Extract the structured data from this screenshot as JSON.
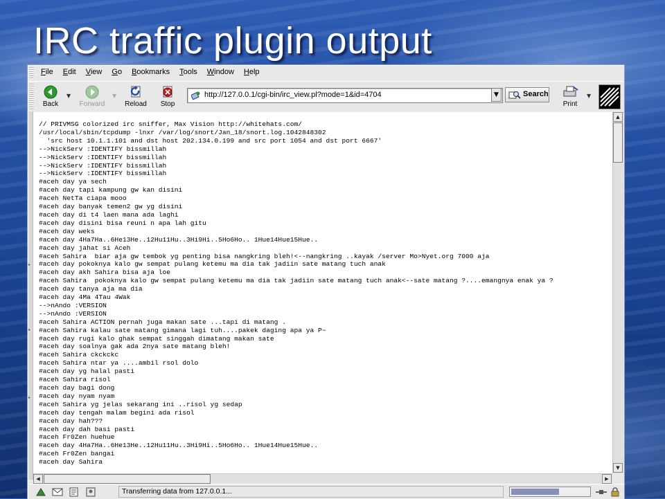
{
  "slide": {
    "title": "IRC traffic plugin output"
  },
  "browser": {
    "menu": [
      {
        "label": "File"
      },
      {
        "label": "Edit"
      },
      {
        "label": "View"
      },
      {
        "label": "Go"
      },
      {
        "label": "Bookmarks"
      },
      {
        "label": "Tools"
      },
      {
        "label": "Window"
      },
      {
        "label": "Help"
      }
    ],
    "toolbar": {
      "back_label": "Back",
      "forward_label": "Forward",
      "reload_label": "Reload",
      "stop_label": "Stop",
      "search_label": "Search",
      "print_label": "Print"
    },
    "url": "http://127.0.0.1/cgi-bin/irc_view.pl?mode=1&id=4704",
    "status_text": "Transferring data from 127.0.0.1...",
    "progress": 0.62,
    "icons": {
      "back": "back-arrow-icon",
      "forward": "forward-arrow-icon",
      "reload": "reload-icon",
      "stop": "stop-icon",
      "search": "search-icon",
      "print": "printer-icon",
      "throbber": "throbber-logo-icon"
    },
    "colors": {
      "accent_green": "#2d9a2d",
      "progress_fill": "#8a8fb8"
    }
  },
  "log_lines": [
    "// PRIVMSG colorized irc sniffer, Max Vision http://whitehats.com/",
    "/usr/local/sbin/tcpdump -lnxr /var/log/snort/Jan_18/snort.log.1042848302",
    "  'src host 10.1.1.101 and dst host 202.134.0.199 and src port 1054 and dst port 6667'",
    "-->NickServ :IDENTIFY bissmillah",
    "-->NickServ :IDENTIFY bissmillah",
    "-->NickServ :IDENTIFY bissmillah",
    "-->NickServ :IDENTIFY bissmillah",
    "#aceh day ya sech",
    "#aceh day tapi kampung gw kan disini",
    "#aceh NetTa ciapa mooo",
    "#aceh day banyak temen2 gw yg disini",
    "#aceh day di t4 laen mana ada laghi",
    "#aceh day disini bisa reuni n apa lah gitu",
    "#aceh day weks",
    "#aceh day 4Ha7Ha..6He13He..12Hu11Hu..3Hi9Hi..5Ho6Ho.. 1Hue14Hue15Hue..",
    "#aceh day jahat si Aceh",
    "#aceh Sahira  biar aja gw tembok yg penting bisa nangkring bleh!<--nangkring ..kayak /server Mo>Nyet.org 7000 aja",
    "#aceh day pokoknya kalo gw sempat pulang ketemu ma dia tak jadiin sate matang tuch anak",
    "#aceh day akh Sahira bisa aja loe",
    "#aceh Sahira  pokoknya kalo gw sempat pulang ketemu ma dia tak jadiin sate matang tuch anak<--sate matang ?....emangnya enak ya ?",
    "#aceh day tanya aja ma dia",
    "#aceh day 4Ma 4Tau 4Wak",
    "-->nAndo :VERSION",
    "-->nAndo :VERSION",
    "#aceh Sahira ACTION pernah juga makan sate ...tapi di matang .",
    "#aceh Sahira kalau sate matang gimana lagi tuh....pakek daging apa ya P~",
    "#aceh day rugi kalo ghak sempat singgah dimatang makan sate",
    "#aceh day soalnya gak ada 2nya sate matang bleh!",
    "#aceh Sahira ckckckc",
    "#aceh Sahira ntar ya ....ambil rsol dolo",
    "#aceh day yg halal pasti",
    "#aceh Sahira risol",
    "#aceh day bagi dong",
    "#aceh day nyam nyam",
    "#aceh Sahira yg jelas sekarang ini ..risol yg sedap",
    "#aceh day tengah malam begini ada risol",
    "#aceh day hah???",
    "#aceh day dah basi pasti",
    "#aceh Fr0Zen huehue",
    "#aceh day 4Ha7Ha..6He13He..12Hu11Hu..3Hi9Hi..5Ho6Ho.. 1Hue14Hue15Hue..",
    "#aceh Fr0Zen bangai",
    "#aceh day Sahira"
  ]
}
